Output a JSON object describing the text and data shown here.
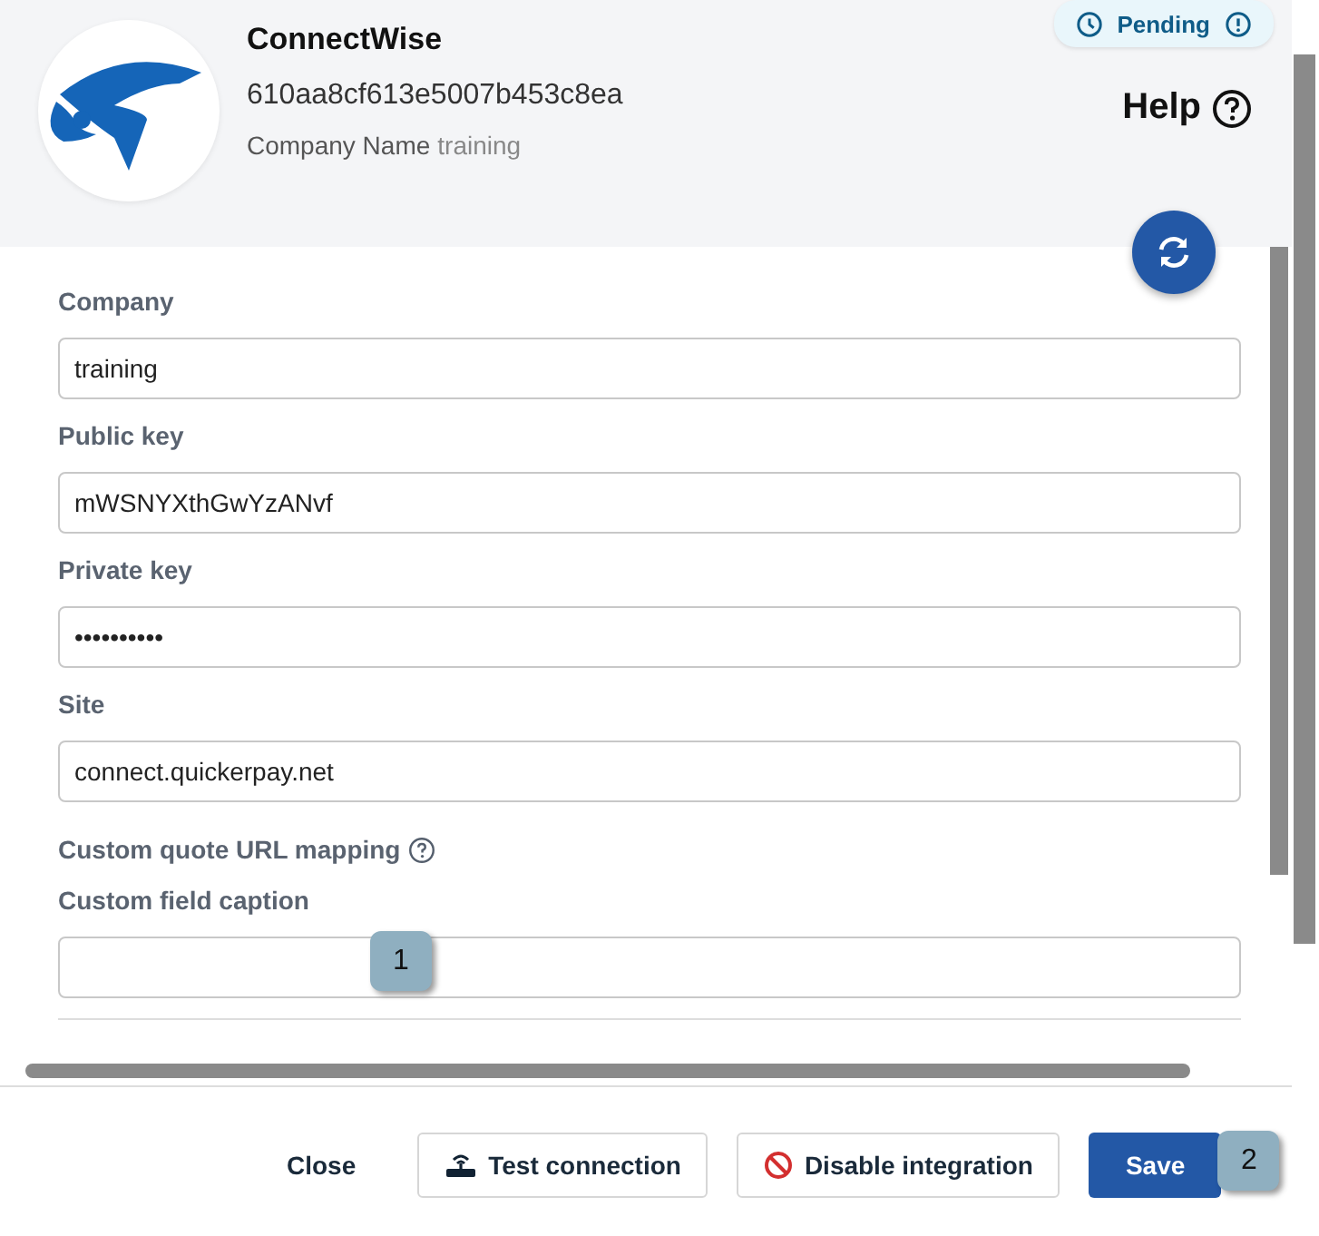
{
  "header": {
    "title": "ConnectWise",
    "id": "610aa8cf613e5007b453c8ea",
    "company_label": "Company Name",
    "company_value": "training",
    "status": "Pending",
    "help": "Help"
  },
  "fields": [
    {
      "label": "Company",
      "value": "training"
    },
    {
      "label": "Public key",
      "value": "mWSNYXthGwYzANvf"
    },
    {
      "label": "Private key",
      "value": "••••••••••"
    },
    {
      "label": "Site",
      "value": "connect.quickerpay.net"
    }
  ],
  "section": {
    "title": "Custom quote URL mapping"
  },
  "caption_field": {
    "label": "Custom field caption"
  },
  "buttons": [
    {
      "label": "Close",
      "kind": "plain"
    },
    {
      "label": "Test connection",
      "kind": "test"
    },
    {
      "label": "Disable integration",
      "kind": "disable"
    },
    {
      "label": "Save",
      "kind": "primary"
    }
  ],
  "callouts": [
    "1",
    "2"
  ]
}
